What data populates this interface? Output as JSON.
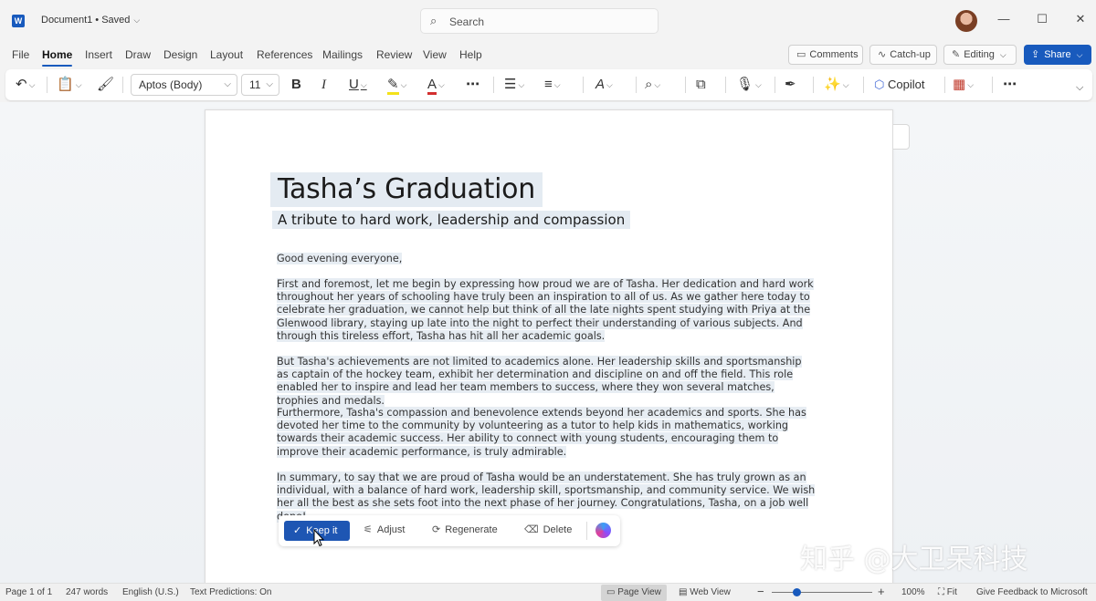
{
  "titlebar": {
    "doc_title": "Document1 • Saved",
    "search_placeholder": "Search",
    "window_controls": [
      "—",
      "☐",
      "✕"
    ]
  },
  "menu": {
    "tabs": [
      "File",
      "Home",
      "Insert",
      "Draw",
      "Design",
      "Layout",
      "References",
      "Mailings",
      "Review",
      "View",
      "Help"
    ],
    "active_tab": "Home",
    "comments": "Comments",
    "catchup": "Catch-up",
    "editing": "Editing",
    "share": "Share"
  },
  "ribbon": {
    "font_name": "Aptos (Body)",
    "font_size": "11",
    "bold": "B",
    "italic": "I",
    "underline": "U",
    "copilot": "Copilot",
    "highlight_color": "#f4e21a",
    "font_color": "#d32f2f"
  },
  "document": {
    "title": "Tasha’s Graduation",
    "subtitle": "A tribute to hard work, leadership and compassion",
    "paragraphs": [
      "Good evening everyone,",
      "First and foremost, let me begin by expressing how proud we are of Tasha. Her dedication and hard work throughout her years of schooling have truly been an inspiration to all of us. As we gather here today to celebrate her graduation, we cannot help but think of all the late nights spent studying with Priya at the Glenwood library, staying up late into the night to perfect their understanding of various subjects. And through this tireless effort, Tasha has hit all her academic goals.",
      "But Tasha's achievements are not limited to academics alone. Her leadership skills and sportsmanship as captain of the hockey team, exhibit her determination and discipline on and off the field. This role enabled her to inspire and lead her team members to success, where they won several matches, trophies and medals.",
      "Furthermore, Tasha's compassion and benevolence extends beyond her academics and sports. She has devoted her time to the community by volunteering as a tutor to help kids in mathematics, working towards their academic success. Her ability to connect with young students, encouraging them to improve their academic performance, is truly admirable.",
      "In summary, to say that we are proud of Tasha would be an understatement. She has truly grown as an individual, with a balance of hard work, leadership skill, sportsmanship, and community service. We wish her all the best as she sets foot into the next phase of her journey. Congratulations, Tasha, on a job well done!"
    ]
  },
  "actions": {
    "keep": "Keep it",
    "adjust": "Adjust",
    "regenerate": "Regenerate",
    "delete": "Delete"
  },
  "watermark": "知乎 @大卫呆科技",
  "status": {
    "page": "Page 1 of 1",
    "words": "247 words",
    "language": "English (U.S.)",
    "predictions": "Text Predictions: On",
    "page_view": "Page View",
    "web_view": "Web View",
    "zoom": "100%",
    "zoom_level": 0.25,
    "fit": "Fit",
    "feedback": "Give Feedback to Microsoft"
  }
}
